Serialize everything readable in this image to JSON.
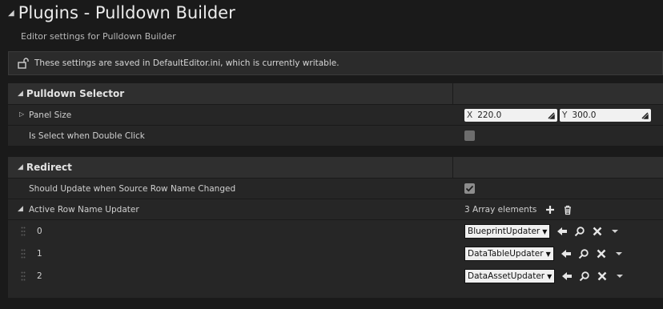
{
  "header": {
    "title": "Plugins - Pulldown Builder",
    "subtitle": "Editor settings for Pulldown Builder"
  },
  "notice": {
    "text": "These settings are saved in DefaultEditor.ini, which is currently writable."
  },
  "sections": {
    "pulldown_selector": {
      "label": "Pulldown Selector",
      "panel_size": {
        "label": "Panel Size",
        "x_axis": "X",
        "x_value": "220.0",
        "y_axis": "Y",
        "y_value": "300.0"
      },
      "double_click": {
        "label": "Is Select when Double Click",
        "checked": false
      }
    },
    "redirect": {
      "label": "Redirect",
      "should_update": {
        "label": "Should Update when Source Row Name Changed",
        "checked": true
      },
      "active_updater": {
        "label": "Active Row Name Updater",
        "count_text": "3 Array elements",
        "elements": [
          {
            "index": "0",
            "value": "BlueprintUpdater"
          },
          {
            "index": "1",
            "value": "DataTableUpdater"
          },
          {
            "index": "2",
            "value": "DataAssetUpdater"
          }
        ]
      }
    }
  },
  "colors": {
    "background": "#1a1a1a",
    "row": "#262626",
    "section": "#2f2f2f"
  }
}
